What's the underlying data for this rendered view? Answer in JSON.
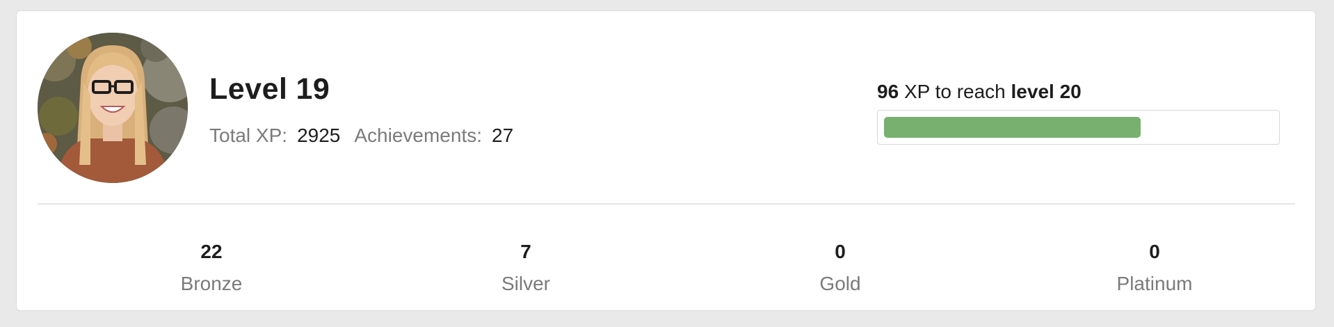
{
  "profile": {
    "level_label": "Level",
    "level_value": "19",
    "total_xp_label": "Total XP:",
    "total_xp_value": "2925",
    "achievements_label": "Achievements:",
    "achievements_value": "27",
    "avatar_icon": "user-photo"
  },
  "progress": {
    "xp_needed": "96",
    "xp_text": "XP to reach",
    "next_level_text": "level 20",
    "fraction": 0.66,
    "fill_color": "#77b06f"
  },
  "medals": [
    {
      "count": "22",
      "label": "Bronze"
    },
    {
      "count": "7",
      "label": "Silver"
    },
    {
      "count": "0",
      "label": "Gold"
    },
    {
      "count": "0",
      "label": "Platinum"
    }
  ]
}
